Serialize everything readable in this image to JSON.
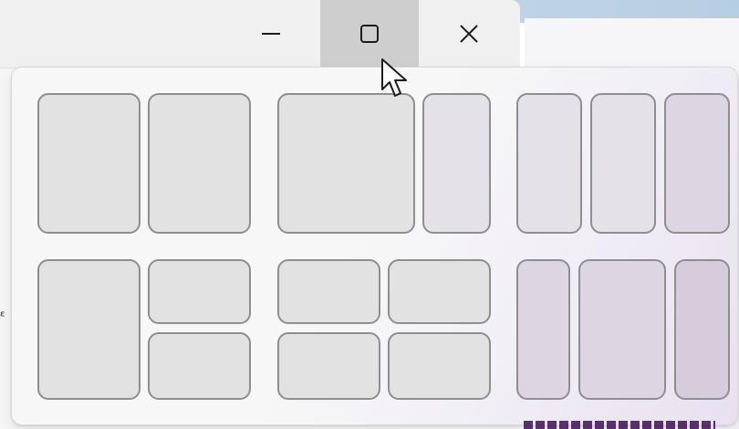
{
  "window": {
    "buttons": {
      "minimize": {
        "icon": "minimize-icon"
      },
      "maximize": {
        "icon": "maximize-icon",
        "state": "hovered"
      },
      "close": {
        "icon": "close-icon"
      }
    }
  },
  "snap_layouts": {
    "layouts": [
      {
        "name": "two-columns-equal",
        "zones": 2
      },
      {
        "name": "two-columns-left-wide",
        "zones": 2
      },
      {
        "name": "three-columns-equal",
        "zones": 3
      },
      {
        "name": "left-column-right-stack",
        "zones": 3
      },
      {
        "name": "four-quadrants",
        "zones": 4
      },
      {
        "name": "three-columns-center-wide",
        "zones": 3
      }
    ]
  },
  "colors": {
    "zone_fill": "#e2e2e2",
    "zone_border": "#8e8e8e",
    "hover_background": "#cecece",
    "tint_purple": "#d6ccdc"
  },
  "cursor": {
    "icon": "mouse-pointer-icon"
  },
  "edge_text": "ᵋ"
}
